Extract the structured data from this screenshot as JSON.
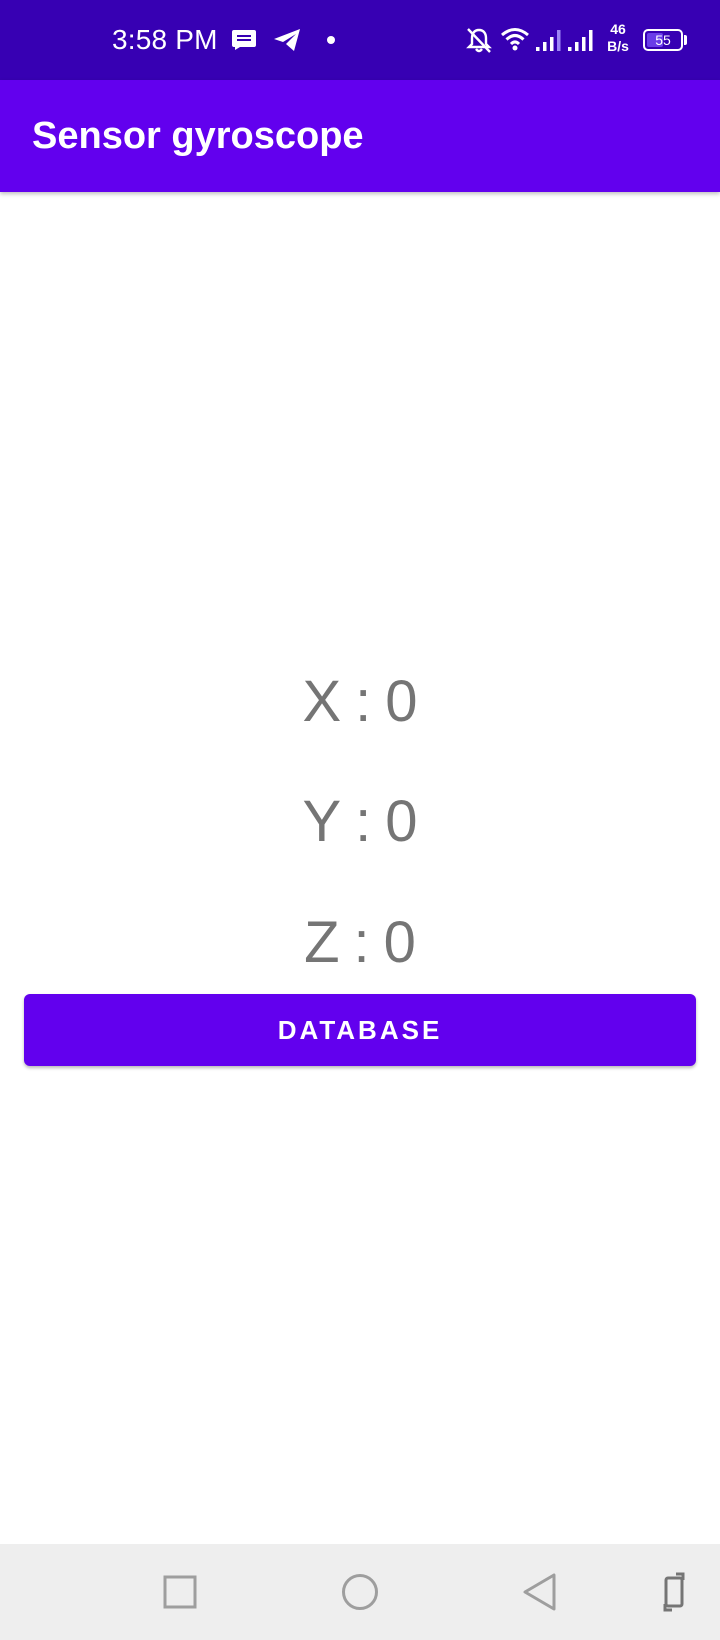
{
  "status_bar": {
    "time": "3:58 PM",
    "net_speed_value": "46",
    "net_speed_unit": "B/s",
    "battery_level": "55",
    "battery_fraction": 0.55,
    "icons": [
      "message-icon",
      "telegram-icon",
      "dot-icon",
      "bell-off-icon",
      "wifi-icon",
      "signal-icon",
      "signal-icon",
      "battery-icon"
    ]
  },
  "app_bar": {
    "title": "Sensor gyroscope"
  },
  "readings": {
    "x_label": "X",
    "x_value": "0",
    "y_label": "Y",
    "y_value": "0",
    "z_label": "Z",
    "z_value": "0",
    "separator": ":"
  },
  "actions": {
    "database_label": "DATABASE"
  },
  "nav_bar": {
    "icons": [
      "recents-icon",
      "home-icon",
      "back-icon",
      "rotate-icon"
    ]
  },
  "colors": {
    "status_bar": "#3700b3",
    "primary": "#6200ee",
    "value_text": "#757575",
    "nav_bar": "#eeeeee"
  }
}
